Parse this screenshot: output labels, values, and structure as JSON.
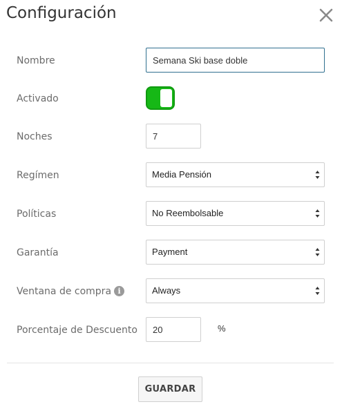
{
  "dialog": {
    "title": "Configuración",
    "close_icon": "close-icon"
  },
  "form": {
    "nombre": {
      "label": "Nombre",
      "value": "Semana Ski base doble"
    },
    "activado": {
      "label": "Activado",
      "on": true,
      "color": "#16b816"
    },
    "noches": {
      "label": "Noches",
      "value": "7"
    },
    "regimen": {
      "label": "Regímen",
      "selected": "Media Pensión"
    },
    "politicas": {
      "label": "Políticas",
      "selected": "No Reembolsable"
    },
    "garantia": {
      "label": "Garantía",
      "selected": "Payment"
    },
    "ventana": {
      "label": "Ventana de compra",
      "selected": "Always",
      "info_icon": "i"
    },
    "descuento": {
      "label": "Porcentaje de Descuento",
      "value": "20",
      "unit": "%"
    }
  },
  "footer": {
    "save_label": "GUARDAR"
  }
}
